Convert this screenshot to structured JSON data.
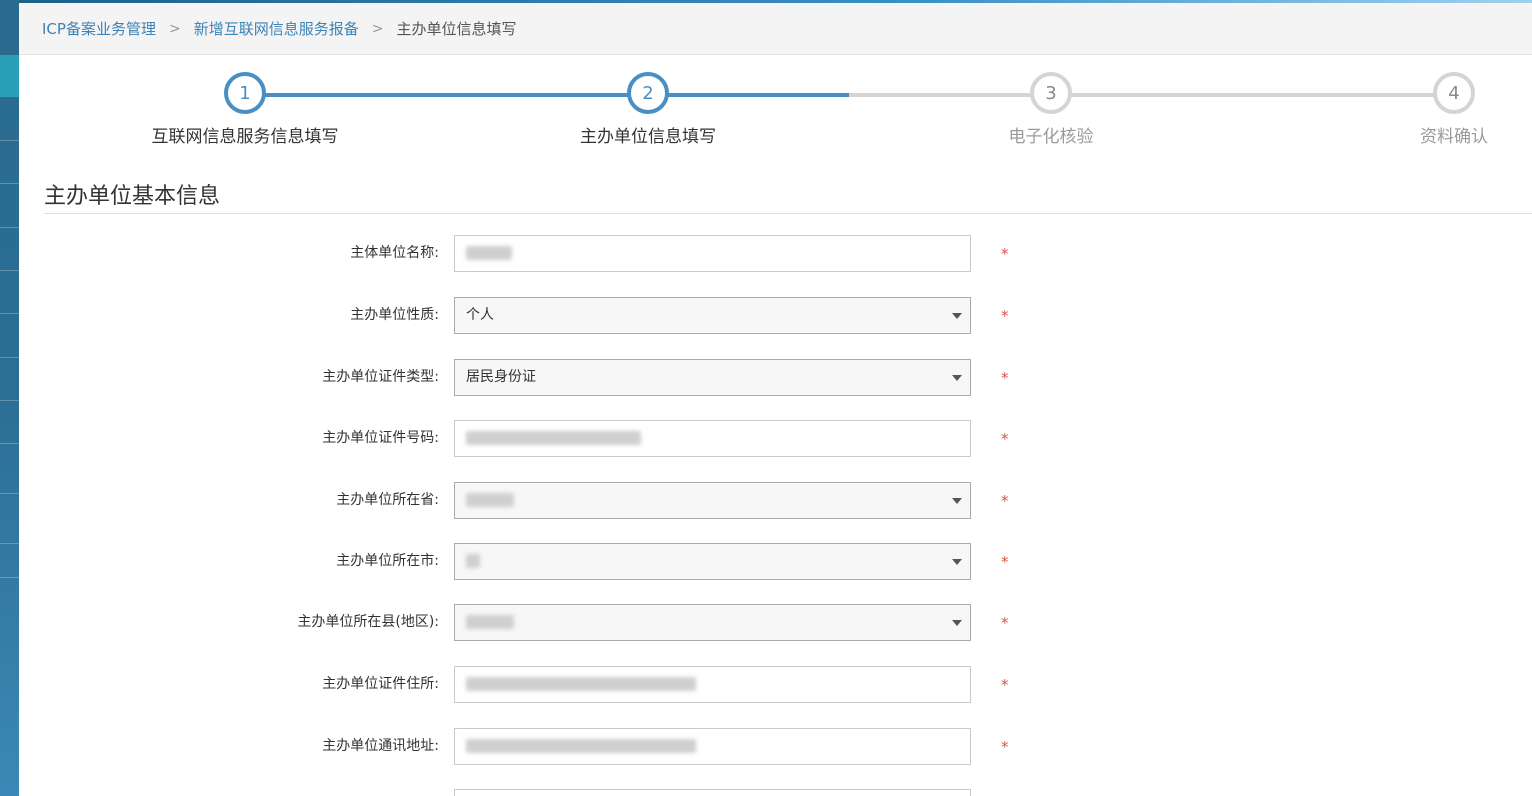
{
  "breadcrumb": {
    "item1": "ICP备案业务管理",
    "item2": "新增互联网信息服务报备",
    "current": "主办单位信息填写",
    "separator": ">"
  },
  "steps": [
    {
      "number": "1",
      "label": "互联网信息服务信息填写",
      "state": "done"
    },
    {
      "number": "2",
      "label": "主办单位信息填写",
      "state": "current"
    },
    {
      "number": "3",
      "label": "电子化核验",
      "state": "pending"
    },
    {
      "number": "4",
      "label": "资料确认",
      "state": "pending"
    }
  ],
  "section": {
    "title": "主办单位基本信息"
  },
  "form": {
    "required_mark": "*",
    "fields": [
      {
        "label": "主体单位名称:",
        "type": "text",
        "value": ""
      },
      {
        "label": "主办单位性质:",
        "type": "select",
        "value": "个人"
      },
      {
        "label": "主办单位证件类型:",
        "type": "select",
        "value": "居民身份证"
      },
      {
        "label": "主办单位证件号码:",
        "type": "text",
        "value": ""
      },
      {
        "label": "主办单位所在省:",
        "type": "select",
        "value": ""
      },
      {
        "label": "主办单位所在市:",
        "type": "select",
        "value": ""
      },
      {
        "label": "主办单位所在县(地区):",
        "type": "select",
        "value": ""
      },
      {
        "label": "主办单位证件住所:",
        "type": "text",
        "value": ""
      },
      {
        "label": "主办单位通讯地址:",
        "type": "text",
        "value": ""
      }
    ]
  },
  "colors": {
    "accent": "#4a8fc4",
    "link": "#3d83b7",
    "required": "#d9534f",
    "pending": "#d4d4d4"
  }
}
